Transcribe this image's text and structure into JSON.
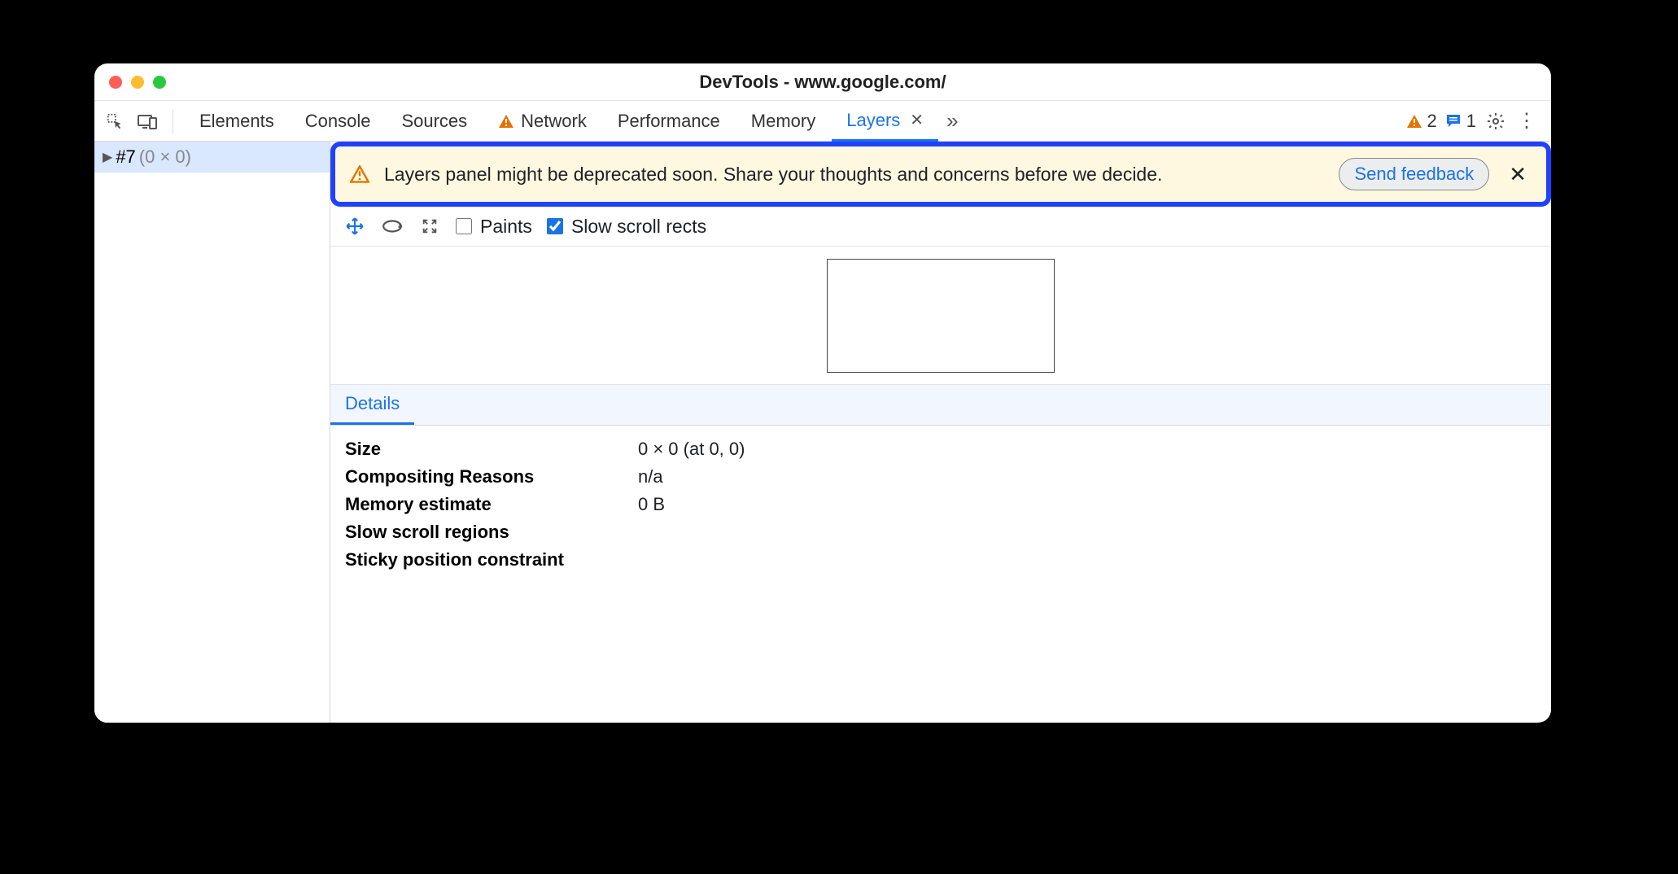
{
  "window": {
    "title": "DevTools - www.google.com/"
  },
  "tabs": {
    "elements": "Elements",
    "console": "Console",
    "sources": "Sources",
    "network": "Network",
    "performance": "Performance",
    "memory": "Memory",
    "layers": "Layers"
  },
  "counters": {
    "issues": "2",
    "messages": "1"
  },
  "tree": {
    "item0": {
      "label": "#7",
      "dims": "(0 × 0)"
    }
  },
  "banner": {
    "text": "Layers panel might be deprecated soon. Share your thoughts and concerns before we decide.",
    "button": "Send feedback"
  },
  "toolbar": {
    "paints_label": "Paints",
    "slow_scroll_label": "Slow scroll rects",
    "paints_checked": false,
    "slow_scroll_checked": true
  },
  "details": {
    "tab": "Details",
    "rows": {
      "size": {
        "k": "Size",
        "v": "0 × 0 (at 0, 0)"
      },
      "compositing": {
        "k": "Compositing Reasons",
        "v": "n/a"
      },
      "memory": {
        "k": "Memory estimate",
        "v": "0 B"
      },
      "slowscroll": {
        "k": "Slow scroll regions",
        "v": ""
      },
      "sticky": {
        "k": "Sticky position constraint",
        "v": ""
      }
    }
  }
}
